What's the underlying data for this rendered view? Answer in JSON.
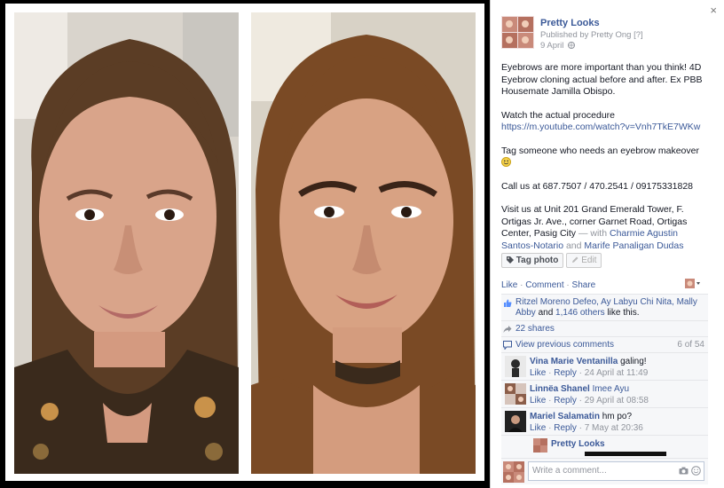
{
  "viewer": {
    "close_glyph": "×"
  },
  "post": {
    "page_name": "Pretty Looks",
    "published_prefix": "Published by",
    "published_by": "Pretty Ong",
    "help_tag": "[?]",
    "date": "9 April",
    "privacy_icon": "globe-icon",
    "paragraph1": "Eyebrows are more important than you think! 4D Eyebrow cloning actual before and after. Ex PBB Housemate Jamilla Obispo.",
    "watch_label": "Watch the actual procedure",
    "watch_url": "https://m.youtube.com/watch?v=Vnh7TkE7WKw",
    "tag_line": "Tag someone who needs an eyebrow makeover",
    "call_line": "Call us at 687.7507 / 470.2541 / 09175331828",
    "visit_line": "Visit us at Unit 201 Grand Emerald Tower, F. Ortigas Jr. Ave., corner Garnet Road, Ortigas Center, Pasig City",
    "with_label": "— with",
    "with_person1": "Charmie Agustin Santos-Notario",
    "and_label": "and",
    "with_person2": "Marife Panaligan Dudas"
  },
  "buttons": {
    "tag_photo": "Tag photo",
    "edit": "Edit"
  },
  "actions": {
    "like": "Like",
    "comment": "Comment",
    "share": "Share",
    "sep": "·"
  },
  "likes": {
    "names": "Ritzel Moreno Defeo, Ay Labyu Chi Nita, Mally Abby",
    "and": "and",
    "others": "1,146 others",
    "suffix": "like this."
  },
  "shares": {
    "label": "22 shares"
  },
  "comments_nav": {
    "view_previous": "View previous comments",
    "count": "6 of 54"
  },
  "comments": [
    {
      "name": "Vina Marie Ventanilla",
      "text": "galing!",
      "like": "Like",
      "reply": "Reply",
      "time": "24 April at 11:49"
    },
    {
      "name": "Linnëa Shanel",
      "text": "Imee Ayu",
      "like": "Like",
      "reply": "Reply",
      "time": "29 April at 08:58"
    },
    {
      "name": "Mariel Salamatin",
      "text": "hm po?",
      "like": "Like",
      "reply": "Reply",
      "time": "7 May at 20:36"
    }
  ],
  "reply": {
    "name": "Pretty Looks"
  },
  "composer": {
    "placeholder": "Write a comment..."
  },
  "colors": {
    "link": "#3b5998",
    "muted": "#90949c",
    "panel": "#f6f7f9"
  }
}
